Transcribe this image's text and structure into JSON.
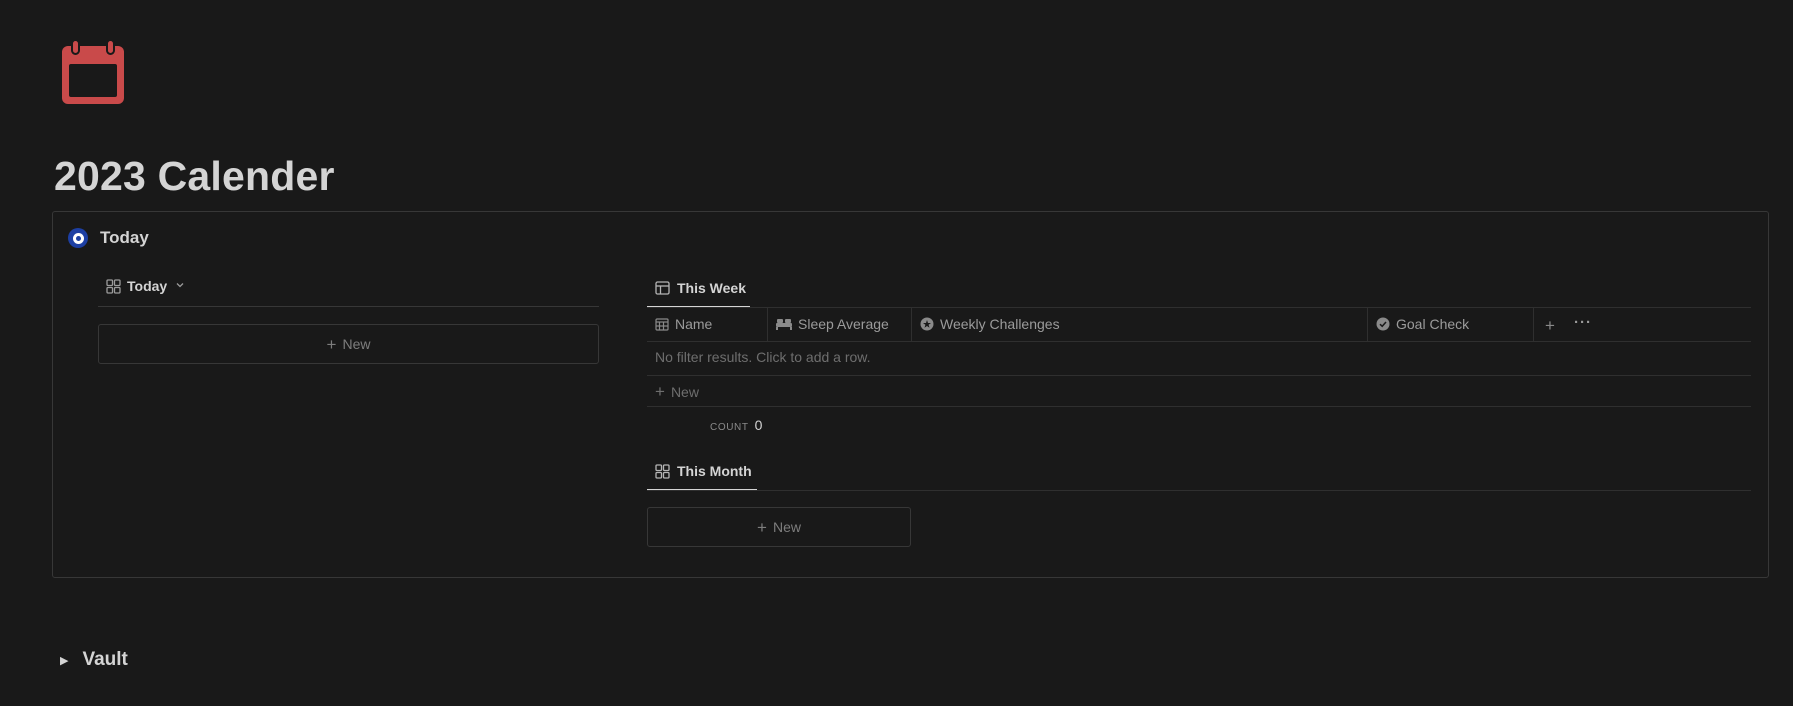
{
  "page": {
    "title": "2023 Calender",
    "icon": "calendar-icon",
    "icon_color": "#c94a4a"
  },
  "callout": {
    "title": "Today",
    "icon": "target-icon",
    "icon_color": "#1d3fa3"
  },
  "left_view": {
    "tab_label": "Today",
    "tab_icon": "gallery-icon",
    "new_label": "New"
  },
  "week_view": {
    "tab_label": "This Week",
    "tab_icon": "table-icon",
    "columns": [
      {
        "label": "Name",
        "icon": "calendar-grid-icon"
      },
      {
        "label": "Sleep Average",
        "icon": "bed-icon"
      },
      {
        "label": "Weekly Challenges",
        "icon": "star-circle-icon"
      },
      {
        "label": "Goal Check",
        "icon": "check-circle-icon"
      }
    ],
    "empty_message": "No filter results. Click to add a row.",
    "new_label": "New",
    "count_label": "COUNT",
    "count_value": "0"
  },
  "month_view": {
    "tab_label": "This Month",
    "tab_icon": "gallery-icon",
    "new_label": "New"
  },
  "vault": {
    "label": "Vault"
  }
}
